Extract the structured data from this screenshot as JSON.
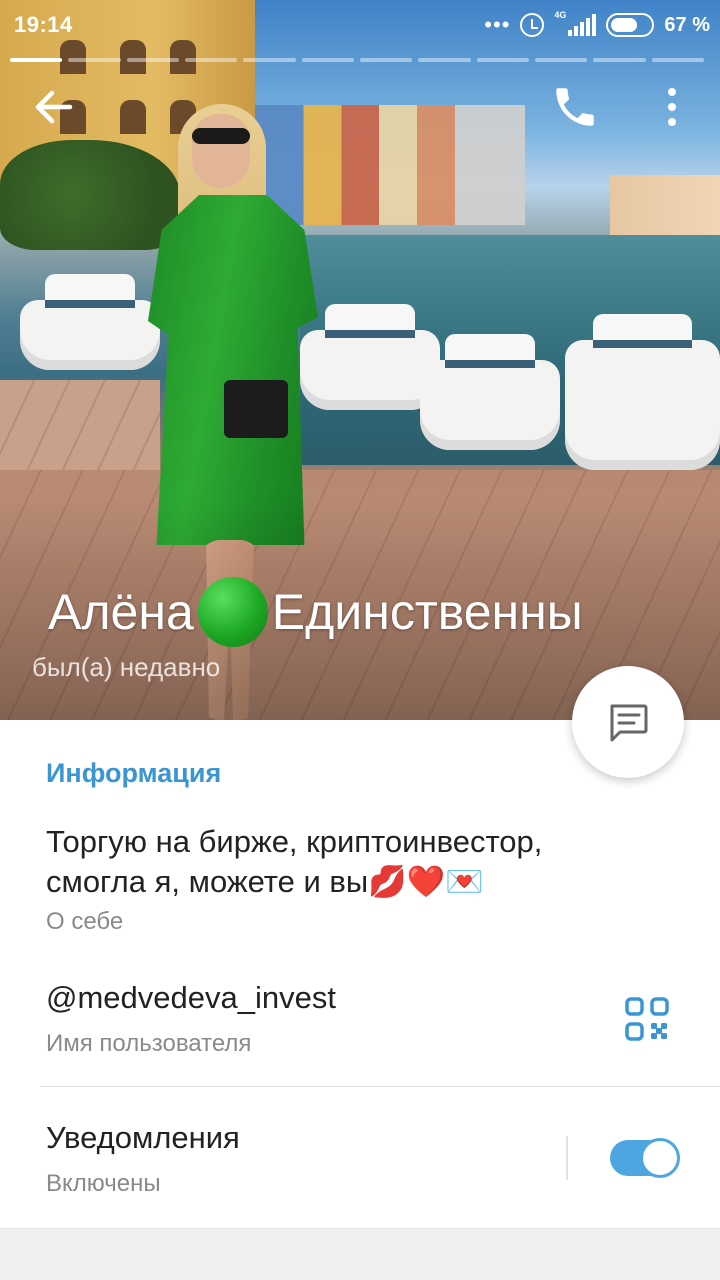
{
  "status_bar": {
    "time": "19:14",
    "dots": "•••",
    "network": "4G",
    "battery_percent": "67 %",
    "battery_level": 0.67
  },
  "story": {
    "segments": 12,
    "active_index": 0
  },
  "profile": {
    "name_first": "Алёна",
    "name_rest": "Единственны",
    "last_seen": "был(а) недавно"
  },
  "info": {
    "section_title": "Информация",
    "bio": "Торгую на бирже, криптоинвестор, смогла я, можете и вы💋❤️💌",
    "bio_label": "О себе",
    "username": "@medvedeva_invest",
    "username_label": "Имя пользователя",
    "notifications_title": "Уведомления",
    "notifications_status": "Включены",
    "notifications_enabled": true
  },
  "colors": {
    "accent": "#3a95d5",
    "toggle": "#4da6e0",
    "status_dot": "#1da824"
  },
  "icons": {
    "back": "arrow-left-icon",
    "call": "phone-icon",
    "menu": "more-vertical-icon",
    "message": "message-icon",
    "qr": "qr-code-icon"
  }
}
